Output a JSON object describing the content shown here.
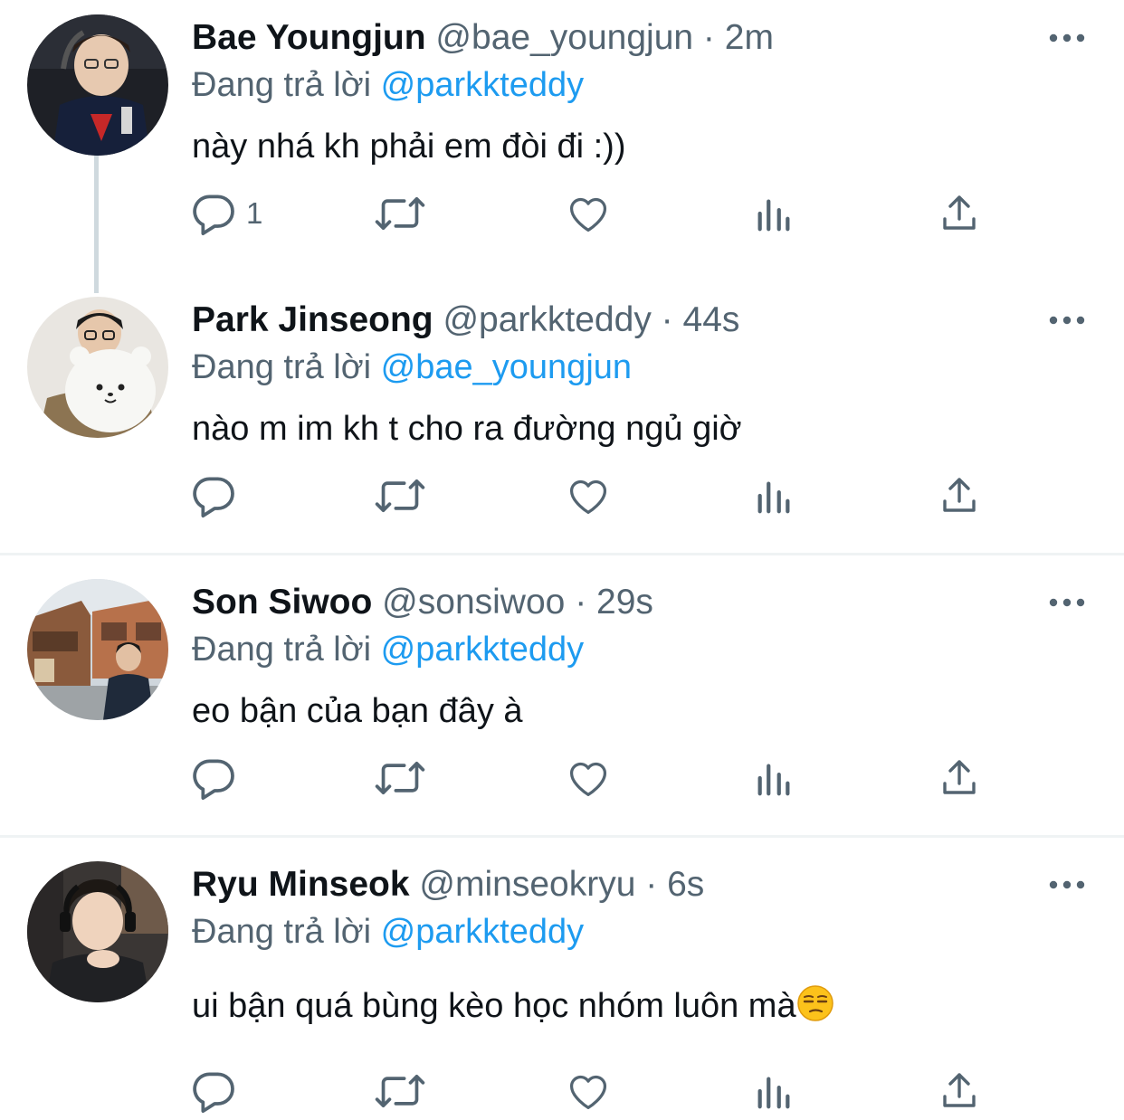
{
  "replying_prefix": "Đang trả lời",
  "tweets": [
    {
      "name": "Bae Youngjun",
      "handle": "@bae_youngjun",
      "separator": "·",
      "time": "2m",
      "reply_to": "@parkkteddy",
      "text": "này nhá kh phải em đòi đi :))",
      "reply_count": "1"
    },
    {
      "name": "Park Jinseong",
      "handle": "@parkkteddy",
      "separator": "·",
      "time": "44s",
      "reply_to": "@bae_youngjun",
      "text": "nào m im kh t cho ra đường ngủ giờ",
      "reply_count": ""
    },
    {
      "name": "Son Siwoo",
      "handle": "@sonsiwoo",
      "separator": "·",
      "time": "29s",
      "reply_to": "@parkkteddy",
      "text": "eo bận của bạn đây à",
      "reply_count": ""
    },
    {
      "name": "Ryu Minseok",
      "handle": "@minseokryu",
      "separator": "·",
      "time": "6s",
      "reply_to": "@parkkteddy",
      "text": "ui bận quá bùng kèo học nhóm luôn mà",
      "emoji": "unamused-face",
      "reply_count": ""
    }
  ],
  "colors": {
    "text": "#0f1419",
    "secondary": "#536471",
    "link": "#1d9bf0",
    "divider": "#eff3f4",
    "thread_line": "#cfd9de"
  },
  "icons": [
    "reply-icon",
    "retweet-icon",
    "like-icon",
    "views-icon",
    "share-icon",
    "more-icon"
  ]
}
